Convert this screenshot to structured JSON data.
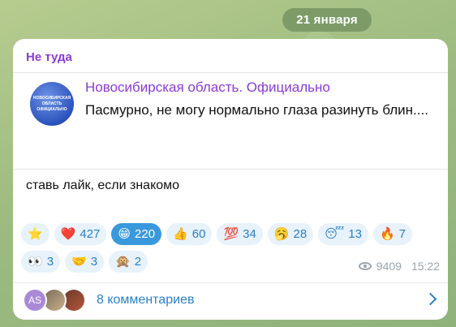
{
  "date_separator": "21 января",
  "reply": {
    "title": "Не туда"
  },
  "quoted": {
    "channel_name": "Новосибирская область. Официально",
    "text": "Пасмурно, не могу нормально глаза разинуть блин....",
    "avatar_text": "НОВОСИБИРСКАЯ ОБЛАСТЬ ОФИЦИАЛЬНО"
  },
  "message": {
    "text": "ставь лайк, если знакомо"
  },
  "reactions": {
    "row1": [
      {
        "emoji": "⭐",
        "count": ""
      },
      {
        "emoji": "❤️",
        "count": "427"
      },
      {
        "emoji": "😁",
        "count": "220",
        "active": true
      },
      {
        "emoji": "👍",
        "count": "60"
      },
      {
        "emoji": "💯",
        "count": "34"
      },
      {
        "emoji": "🥱",
        "count": "28"
      },
      {
        "emoji": "😴",
        "count": "13"
      },
      {
        "emoji": "🔥",
        "count": "7"
      }
    ],
    "row2": [
      {
        "emoji": "👀",
        "count": "3"
      },
      {
        "emoji": "🤝",
        "count": "3"
      },
      {
        "emoji": "🙊",
        "count": "2"
      }
    ]
  },
  "meta": {
    "views": "9409",
    "time": "15:22"
  },
  "footer": {
    "avatar_initials": "AS",
    "comments_label": "8 комментариев"
  },
  "colors": {
    "accent_purple": "#8a3bd6",
    "link_blue": "#2b7fc4",
    "active_reaction": "#3a98dd"
  }
}
